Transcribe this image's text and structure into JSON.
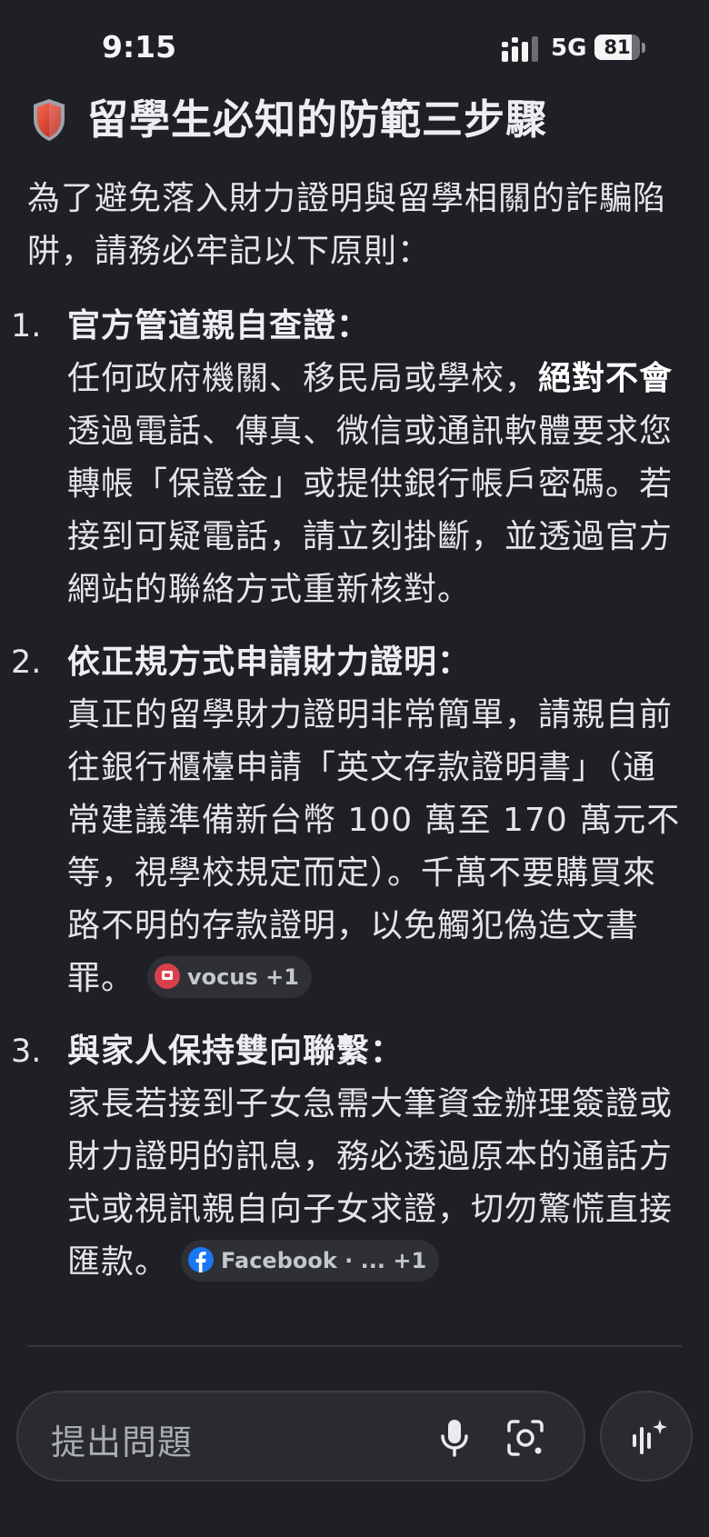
{
  "status_bar": {
    "time": "9:15",
    "network": "5G",
    "battery": "81",
    "battery_fraction": 0.81
  },
  "content": {
    "heading_icon": "shield-icon",
    "heading": "留學生必知的防範三步驟",
    "intro": "為了避免落入財力證明與留學相關的詐騙陷阱，請務必牢記以下原則：",
    "items": [
      {
        "number": "1.",
        "title": "官方管道親自查證：",
        "text_a": "任何政府機關、移民局或學校，",
        "text_bold": "絕對不會",
        "text_b": "透過電話、傳真、微信或通訊軟體要求您轉帳「保證金」或提供銀行帳戶密碼。若接到可疑電話，請立刻掛斷，並透過官方網站的聯絡方式重新核對。"
      },
      {
        "number": "2.",
        "title": "依正規方式申請財力證明：",
        "text": "真正的留學財力證明非常簡單，請親自前往銀行櫃檯申請「英文存款證明書」（通常建議準備新台幣 100 萬至 170 萬元不等，視學校規定而定）。千萬不要購買來路不明的存款證明，以免觸犯偽造文書罪。",
        "source_chip": "vocus +1",
        "source_icon": "vocus-icon"
      },
      {
        "number": "3.",
        "title": "與家人保持雙向聯繫：",
        "text": "家長若接到子女急需大筆資金辦理簽證或財力證明的訊息，務必透過原本的通話方式或視訊親自向子女求證，切勿驚慌直接匯款。",
        "source_chip": "Facebook · ... +1",
        "source_icon": "facebook-icon"
      }
    ]
  },
  "input_bar": {
    "placeholder": "提出問題",
    "mic_icon": "mic-icon",
    "camera_icon": "camera-search-icon",
    "live_icon": "live-sparkle-icon"
  },
  "colors": {
    "background": "#1f2025",
    "text": "#e3e5e8",
    "chip_background": "#2e3036",
    "vocus_red": "#d9404b",
    "facebook_blue": "#1877f2"
  }
}
